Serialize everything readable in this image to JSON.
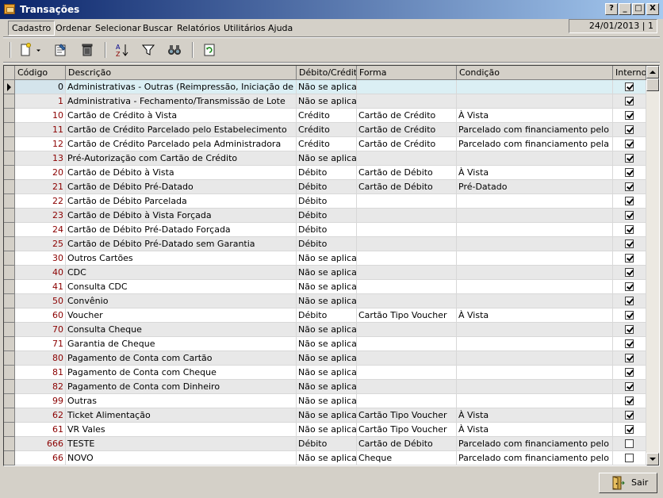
{
  "window": {
    "title": "Transações"
  },
  "title_buttons": [
    "?",
    "_",
    "□",
    "X"
  ],
  "menu": {
    "items": [
      "Cadastro",
      "Ordenar",
      "Selecionar",
      "Buscar",
      "Relatórios",
      "Utilitários",
      "Ajuda"
    ]
  },
  "status": {
    "date": "24/01/2013 | 1"
  },
  "toolbar": {
    "icons": [
      "new-icon",
      "dropdown-arrow-icon",
      "edit-icon",
      "delete-icon",
      "sort-icon",
      "filter-icon",
      "search-binoculars-icon",
      "refresh-icon"
    ]
  },
  "table": {
    "headers": [
      "Código",
      "Descrição",
      "Débito/Crédito",
      "Forma",
      "Condição",
      "Interno"
    ],
    "rows": [
      {
        "code": "0",
        "desc": "Administrativas - Outras (Reimpressão, Iniciação de Terminal",
        "dc": "Não se aplica",
        "forma": "",
        "cond": "",
        "interno": true
      },
      {
        "code": "1",
        "desc": "Administrativa - Fechamento/Transmissão de Lote",
        "dc": "Não se aplica",
        "forma": "",
        "cond": "",
        "interno": true
      },
      {
        "code": "10",
        "desc": "Cartão de Crédito à Vista",
        "dc": "Crédito",
        "forma": "Cartão de Crédito",
        "cond": "À Vista",
        "interno": true
      },
      {
        "code": "11",
        "desc": "Cartão de Crédito Parcelado pelo Estabelecimento",
        "dc": "Crédito",
        "forma": "Cartão de Crédito",
        "cond": "Parcelado com financiamento pelo estabelecimento",
        "interno": true
      },
      {
        "code": "12",
        "desc": "Cartão de Crédito Parcelado pela Administradora",
        "dc": "Crédito",
        "forma": "Cartão de Crédito",
        "cond": "Parcelado com financiamento pela administradora",
        "interno": true
      },
      {
        "code": "13",
        "desc": "Pré-Autorização com Cartão de Crédito",
        "dc": "Não se aplica",
        "forma": "",
        "cond": "",
        "interno": true
      },
      {
        "code": "20",
        "desc": "Cartão de Débito à Vista",
        "dc": "Débito",
        "forma": "Cartão de Débito",
        "cond": "À Vista",
        "interno": true
      },
      {
        "code": "21",
        "desc": "Cartão de Débito Pré-Datado",
        "dc": "Débito",
        "forma": "Cartão de Débito",
        "cond": "Pré-Datado",
        "interno": true
      },
      {
        "code": "22",
        "desc": "Cartão de Débito Parcelada",
        "dc": "Débito",
        "forma": "",
        "cond": "",
        "interno": true
      },
      {
        "code": "23",
        "desc": "Cartão de Débito à Vista Forçada",
        "dc": "Débito",
        "forma": "",
        "cond": "",
        "interno": true
      },
      {
        "code": "24",
        "desc": "Cartão de Débito Pré-Datado Forçada",
        "dc": "Débito",
        "forma": "",
        "cond": "",
        "interno": true
      },
      {
        "code": "25",
        "desc": "Cartão de Débito Pré-Datado sem Garantia",
        "dc": "Débito",
        "forma": "",
        "cond": "",
        "interno": true
      },
      {
        "code": "30",
        "desc": "Outros Cartões",
        "dc": "Não se aplica",
        "forma": "",
        "cond": "",
        "interno": true
      },
      {
        "code": "40",
        "desc": "CDC",
        "dc": "Não se aplica",
        "forma": "",
        "cond": "",
        "interno": true
      },
      {
        "code": "41",
        "desc": "Consulta CDC",
        "dc": "Não se aplica",
        "forma": "",
        "cond": "",
        "interno": true
      },
      {
        "code": "50",
        "desc": "Convênio",
        "dc": "Não se aplica",
        "forma": "",
        "cond": "",
        "interno": true
      },
      {
        "code": "60",
        "desc": "Voucher",
        "dc": "Débito",
        "forma": "Cartão Tipo Voucher",
        "cond": "À Vista",
        "interno": true
      },
      {
        "code": "70",
        "desc": "Consulta Cheque",
        "dc": "Não se aplica",
        "forma": "",
        "cond": "",
        "interno": true
      },
      {
        "code": "71",
        "desc": "Garantia de Cheque",
        "dc": "Não se aplica",
        "forma": "",
        "cond": "",
        "interno": true
      },
      {
        "code": "80",
        "desc": "Pagamento de Conta com Cartão",
        "dc": "Não se aplica",
        "forma": "",
        "cond": "",
        "interno": true
      },
      {
        "code": "81",
        "desc": "Pagamento de Conta com Cheque",
        "dc": "Não se aplica",
        "forma": "",
        "cond": "",
        "interno": true
      },
      {
        "code": "82",
        "desc": "Pagamento de Conta com Dinheiro",
        "dc": "Não se aplica",
        "forma": "",
        "cond": "",
        "interno": true
      },
      {
        "code": "99",
        "desc": "Outras",
        "dc": "Não se aplica",
        "forma": "",
        "cond": "",
        "interno": true
      },
      {
        "code": "62",
        "desc": "Ticket Alimentação",
        "dc": "Não se aplica",
        "forma": "Cartão Tipo Voucher",
        "cond": "À Vista",
        "interno": true
      },
      {
        "code": "61",
        "desc": "VR Vales",
        "dc": "Não se aplica",
        "forma": "Cartão Tipo Voucher",
        "cond": "À Vista",
        "interno": true
      },
      {
        "code": "666",
        "desc": "TESTE",
        "dc": "Débito",
        "forma": "Cartão de Débito",
        "cond": "Parcelado com financiamento pelo estabelecimento",
        "interno": false
      },
      {
        "code": "66",
        "desc": "NOVO",
        "dc": "Não se aplica",
        "forma": "Cheque",
        "cond": "Parcelado com financiamento pelo estabelecimento",
        "interno": false
      }
    ]
  },
  "footer": {
    "exit_label": "Sair"
  },
  "colors": {
    "title_start": "#0a246a",
    "title_end": "#a6caf0",
    "code_text": "#8b0000",
    "selected_row": "#dbeff4"
  }
}
